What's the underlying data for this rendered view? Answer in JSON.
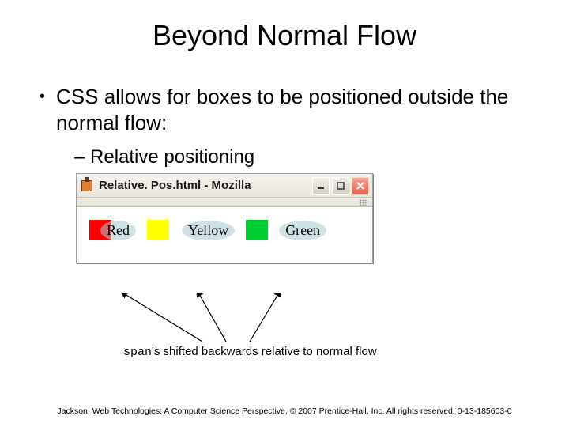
{
  "title": "Beyond Normal Flow",
  "bullet1": "CSS allows for boxes to be positioned outside the normal flow:",
  "bullet2": "– Relative positioning",
  "browser": {
    "title": "Relative. Pos.html - Mozilla",
    "swatches": {
      "red_label": "Red",
      "yellow_label": "Yellow",
      "green_label": "Green"
    }
  },
  "caption": {
    "code": "span",
    "rest": "'s shifted backwards relative to normal flow"
  },
  "footer": "Jackson, Web Technologies: A Computer Science Perspective, © 2007 Prentice-Hall, Inc. All rights reserved. 0-13-185603-0"
}
